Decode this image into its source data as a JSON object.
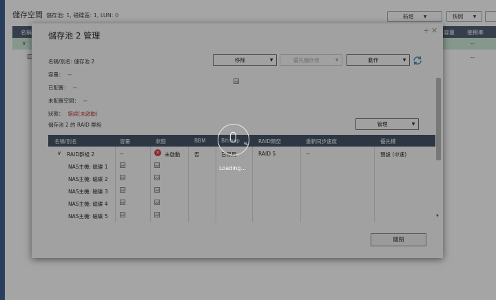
{
  "background": {
    "title": "儲存空間",
    "stats_prefix": "儲存池: 1, 磁碟區: 1, LUN: ",
    "stats_lun": "0",
    "new_button": "新增",
    "snapshot_button": "快照",
    "table_head_name": "名稱",
    "table_head_capacity": "容量",
    "table_head_usage": "使用率",
    "dash": "--"
  },
  "dialog": {
    "title": "儲存池 2 管理",
    "name_label": "名稱/別名:",
    "name_value": "儲存池 2",
    "remove_button": "移除",
    "priority_button": "優先儲存池",
    "action_button": "動作",
    "capacity_label": "容量：",
    "capacity_value": "--",
    "allocated_label": "已配置：",
    "allocated_value": "--",
    "unallocated_label": "未配置空間：",
    "unallocated_value": "--",
    "status_label": "狀態：",
    "status_value": "錯誤(未啟動)",
    "raid_group_title": "儲存池 2 的 RAID 群組",
    "manage_button": "管理",
    "close_button": "關閉"
  },
  "raid_table": {
    "headers": [
      "名稱/別名",
      "容量",
      "狀態",
      "BBM",
      "Bitmap",
      "RAID類型",
      "重新同步速度",
      "優先權"
    ],
    "group": {
      "name": "RAID群組 2",
      "capacity": "--",
      "status": "未啟動",
      "bbm": "否",
      "bitmap": "已停用",
      "raid_type": "RAID 5",
      "resync": "--",
      "priority": "預設 (中速)"
    },
    "disks": [
      "NAS主機: 磁碟 1",
      "NAS主機: 磁碟 2",
      "NAS主機: 磁碟 3",
      "NAS主機: 磁碟 4",
      "NAS主機: 磁碟 5"
    ]
  },
  "loader": {
    "value": "0",
    "unit": "%",
    "text": "Loading..."
  }
}
